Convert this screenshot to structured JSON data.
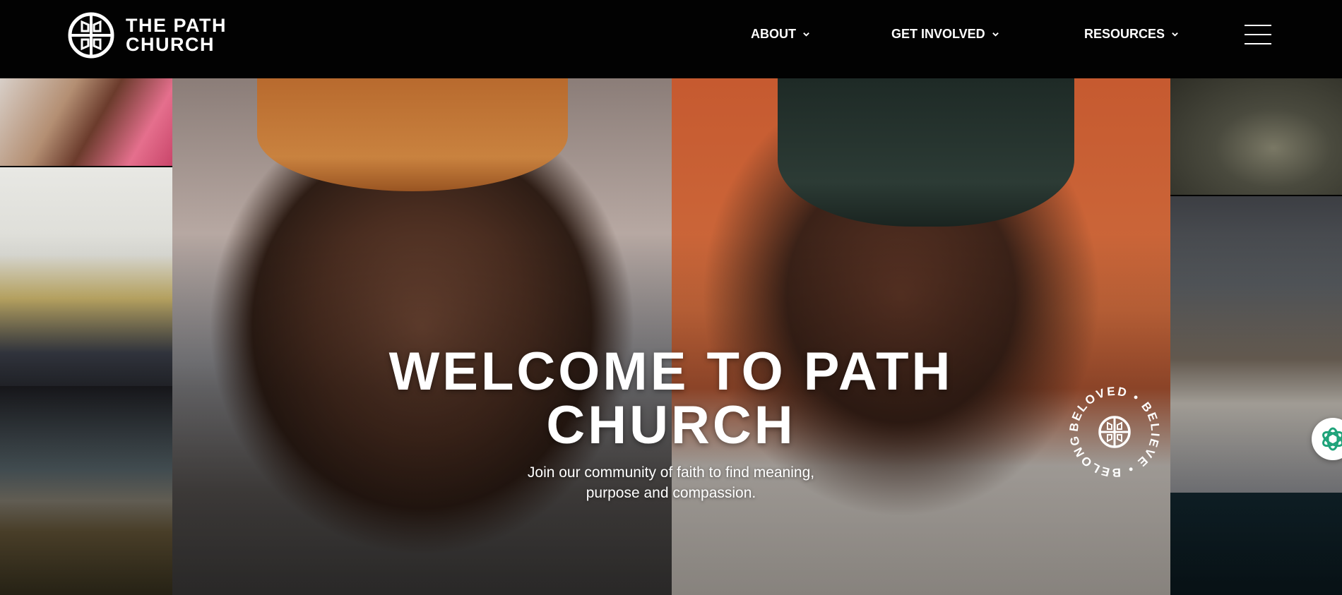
{
  "brand": {
    "name_line1": "THE PATH",
    "name_line2": "CHURCH"
  },
  "nav": {
    "about_label": "ABOUT",
    "involved_label": "GET INVOLVED",
    "resources_label": "RESOURCES",
    "menu_icon": "hamburger-icon",
    "chevron_icon": "chevron-down-icon"
  },
  "hero": {
    "title_line1": "WELCOME TO PATH",
    "title_line2": "CHURCH",
    "subtitle_line1": "Join our community of faith to find meaning,",
    "subtitle_line2": "purpose and compassion."
  },
  "badge": {
    "words": [
      "BELOVED",
      "BELIEVE",
      "BELONG"
    ],
    "text": "BELOVED • BELIEVE • BELONG •"
  },
  "chat": {
    "icon": "chat-assistant-icon",
    "color": "#1fa37a"
  },
  "colors": {
    "header_bg": "#020202",
    "text": "#ffffff",
    "accent_green": "#1fa37a"
  }
}
